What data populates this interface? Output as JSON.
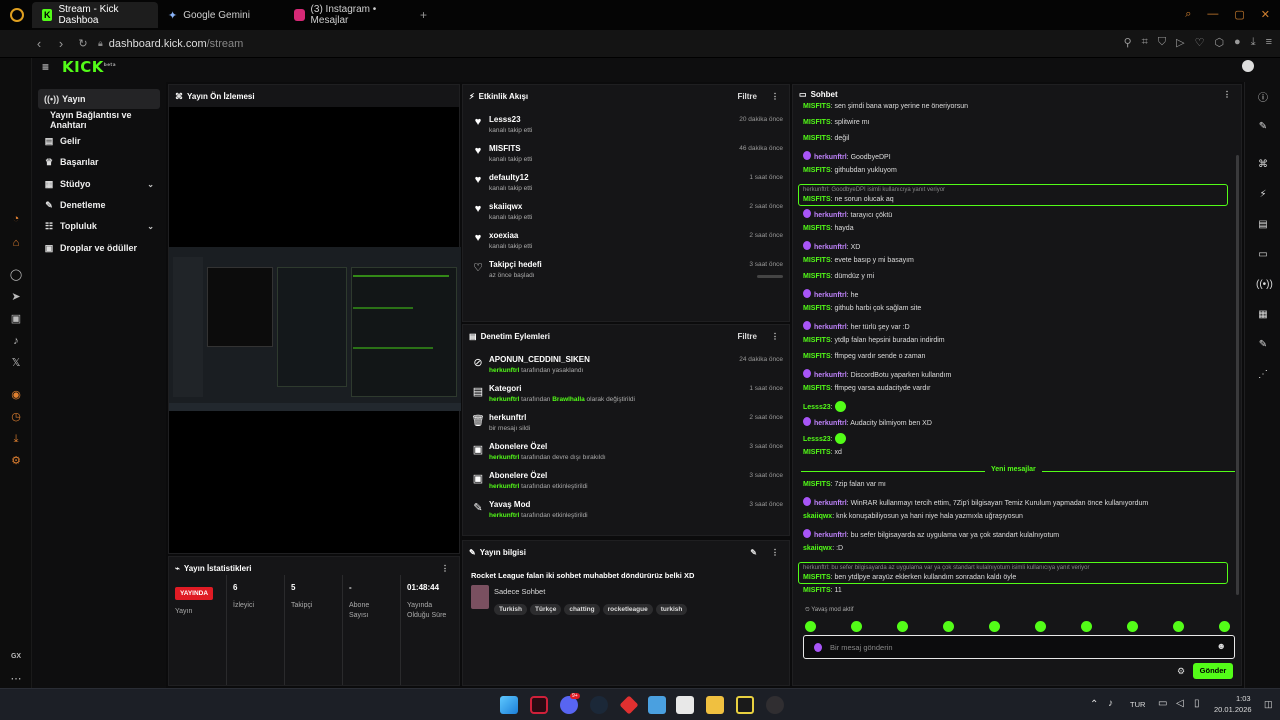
{
  "browser": {
    "tabs": [
      {
        "title": "Stream - Kick Dashboa",
        "active": true,
        "icon": "kick-logo-icon"
      },
      {
        "title": "Google Gemini",
        "active": false,
        "icon": "gemini-icon"
      },
      {
        "title": "(3) Instagram • Mesajlar",
        "active": false,
        "icon": "instagram-icon"
      }
    ],
    "url_host": "dashboard.kick.com",
    "url_path": "/stream",
    "new_tab": "+"
  },
  "kick": {
    "logo": "KICK",
    "logo_sup": "beta",
    "nav": [
      {
        "label": "Yayın",
        "icon": "broadcast-icon",
        "active": true
      },
      {
        "label": "Yayın Bağlantısı ve Anahtarı",
        "icon": "",
        "active": false
      },
      {
        "label": "Gelir",
        "icon": "money-icon",
        "active": false
      },
      {
        "label": "Başarılar",
        "icon": "trophy-icon",
        "active": false
      },
      {
        "label": "Stüdyo",
        "icon": "studio-icon",
        "active": false,
        "chevron": true
      },
      {
        "label": "Denetleme",
        "icon": "wrench-icon",
        "active": false
      },
      {
        "label": "Topluluk",
        "icon": "people-icon",
        "active": false,
        "chevron": true
      },
      {
        "label": "Droplar ve ödüller",
        "icon": "gift-icon",
        "active": false
      }
    ]
  },
  "preview": {
    "title": "Yayın Ön İzlemesi"
  },
  "stats": {
    "title": "Yayın İstatistikleri",
    "live_badge": "YAYINDA",
    "columns": [
      {
        "value": "",
        "label": "Yayın"
      },
      {
        "value": "6",
        "label": "İzleyici"
      },
      {
        "value": "5",
        "label": "Takipçi"
      },
      {
        "value": "-",
        "label": "Abone Sayısı"
      },
      {
        "value": "01:48:44",
        "label": "Yayında Olduğu Süre"
      }
    ]
  },
  "activity": {
    "title": "Etkinlik Akışı",
    "filter": "Filtre",
    "items": [
      {
        "name": "Lesss23",
        "sub": "kanalı takip etti",
        "time": "20 dakika önce",
        "icon": "heart-icon"
      },
      {
        "name": "MISFITS",
        "sub": "kanalı takip etti",
        "time": "46 dakika önce",
        "icon": "heart-icon"
      },
      {
        "name": "defaulty12",
        "sub": "kanalı takip etti",
        "time": "1 saat önce",
        "icon": "heart-icon"
      },
      {
        "name": "skaiiqwx",
        "sub": "kanalı takip etti",
        "time": "2 saat önce",
        "icon": "heart-icon"
      },
      {
        "name": "xoexiaa",
        "sub": "kanalı takip etti",
        "time": "2 saat önce",
        "icon": "heart-icon"
      },
      {
        "name": "Takipçi hedefi",
        "sub": "az önce başladı",
        "time": "3 saat önce",
        "icon": "heart-outline-icon"
      }
    ]
  },
  "moderation": {
    "title": "Denetim Eylemleri",
    "filter": "Filtre",
    "items": [
      {
        "name": "APONUN_CEDDINI_SIKEN",
        "actor": "herkunftrl",
        "rest": " tarafından yasaklandı",
        "highlight": "",
        "rest2": "",
        "time": "24 dakika önce",
        "icon": "ban-icon"
      },
      {
        "name": "Kategori",
        "actor": "herkunftrl",
        "rest": " tarafından ",
        "highlight": "Brawlhalla",
        "rest2": " olarak değiştirildi",
        "time": "1 saat önce",
        "icon": "category-icon"
      },
      {
        "name": "herkunftrl",
        "actor": "",
        "rest": "bir mesajı sildi",
        "highlight": "",
        "rest2": "",
        "time": "2 saat önce",
        "icon": "trash-icon"
      },
      {
        "name": "Abonelere Özel",
        "actor": "herkunftrl",
        "rest": " tarafından devre dışı bırakıldı",
        "highlight": "",
        "rest2": "",
        "time": "3 saat önce",
        "icon": "gift-icon"
      },
      {
        "name": "Abonelere Özel",
        "actor": "herkunftrl",
        "rest": " tarafından etkinleştirildi",
        "highlight": "",
        "rest2": "",
        "time": "3 saat önce",
        "icon": "gift-icon"
      },
      {
        "name": "Yavaş Mod",
        "actor": "herkunftrl",
        "rest": " tarafından etkinleştirildi",
        "highlight": "",
        "rest2": "",
        "time": "3 saat önce",
        "icon": "slow-mode-icon"
      }
    ]
  },
  "stream_info": {
    "title": "Yayın bilgisi",
    "stream_title": "Rocket League falan iki sohbet muhabbet döndürürüz belki XD",
    "category": "Sadece Sohbet",
    "tags": [
      "Turkish",
      "Türkçe",
      "chatting",
      "rocketleague",
      "turkish"
    ]
  },
  "chat": {
    "title": "Sohbet",
    "new_messages": "Yeni mesajlar",
    "slow_mode": "Yavaş mod aktif",
    "input_placeholder": "Bir mesaj gönderin",
    "send": "Gönder",
    "messages": [
      {
        "user": "MISFITS",
        "text": "sen şimdi bana warp yerine ne öneriyorsun",
        "purple": false
      },
      {
        "user": "MISFITS",
        "text": "splitwire mı",
        "purple": false
      },
      {
        "user": "MISFITS",
        "text": "değil",
        "purple": false
      },
      {
        "user": "herkunftrl",
        "text": "GoodbyeDPI",
        "purple": true
      },
      {
        "user": "MISFITS",
        "text": "githubdan yukluyom",
        "purple": false
      },
      {
        "reply": true,
        "ctx": "herkunftrl: GoodbyeDPI isimli kullanıcıya yanıt veriyor",
        "user": "MISFITS",
        "text": "ne sorun olucak aq"
      },
      {
        "user": "herkunftrl",
        "text": "tarayıcı çöktü",
        "purple": true
      },
      {
        "user": "MISFITS",
        "text": "hayda",
        "purple": false
      },
      {
        "user": "herkunftrl",
        "text": "XD",
        "purple": true
      },
      {
        "user": "MISFITS",
        "text": "evete basıp y mi basayım",
        "purple": false
      },
      {
        "user": "MISFITS",
        "text": "dümdüz y mi",
        "purple": false
      },
      {
        "user": "herkunftrl",
        "text": "he",
        "purple": true
      },
      {
        "user": "MISFITS",
        "text": "github harbi çok sağlam site",
        "purple": false
      },
      {
        "user": "herkunftrl",
        "text": "her türlü şey var :D",
        "purple": true
      },
      {
        "user": "MISFITS",
        "text": "ytdlp falan hepsini buradan indirdim",
        "purple": false
      },
      {
        "user": "MISFITS",
        "text": "ffmpeg vardır sende o zaman",
        "purple": false
      },
      {
        "user": "herkunftrl",
        "text": "DiscordBotu yaparken kullandım",
        "purple": true
      },
      {
        "user": "MISFITS",
        "text": "ffmpeg varsa audacityde vardır",
        "purple": false
      },
      {
        "user": "Lesss23",
        "text": "",
        "purple": false,
        "emote": true
      },
      {
        "user": "herkunftrl",
        "text": "Audacity bilmiyom ben XD",
        "purple": true
      },
      {
        "user": "Lesss23",
        "text": "",
        "purple": false,
        "emote": true
      },
      {
        "user": "MISFITS",
        "text": "xd",
        "purple": false
      },
      {
        "divider": true
      },
      {
        "user": "MISFITS",
        "text": "7zip falan var mı",
        "purple": false
      },
      {
        "user": "herkunftrl",
        "text": "WinRAR kullanmayı tercih ettim, 7Zip'i bilgisayarı Temiz Kurulum yapmadan önce kullanıyordum",
        "purple": true
      },
      {
        "user": "skaiiqwx",
        "text": "knk konuşabiliyosun ya hani niye hala yazmıxla uğraşıyosun",
        "purple": false
      },
      {
        "user": "herkunftrl",
        "text": "bu sefer bilgisayarda az uygulama var ya çok standart kulalnıyotum",
        "purple": true
      },
      {
        "user": "skaiiqwx",
        "text": ":D",
        "purple": false
      },
      {
        "reply": true,
        "ctx": "herkunftrl: bu sefer bilgisayarda az uygulama var ya çok standart kulalnıyotum isimli kullanıcıya yanıt veriyor",
        "user": "MISFITS",
        "text": "ben ytdlpye arayüz eklerken kullandım sonradan kaldı öyle"
      },
      {
        "user": "MISFITS",
        "text": "11",
        "purple": false
      }
    ]
  },
  "taskbar": {
    "lang": "TUR",
    "time": "1:03",
    "date": "20.01.2026",
    "notif_badge": "9+"
  },
  "colors": {
    "accent": "#53fc18",
    "live": "#e01b24",
    "purple": "#a855f7"
  }
}
